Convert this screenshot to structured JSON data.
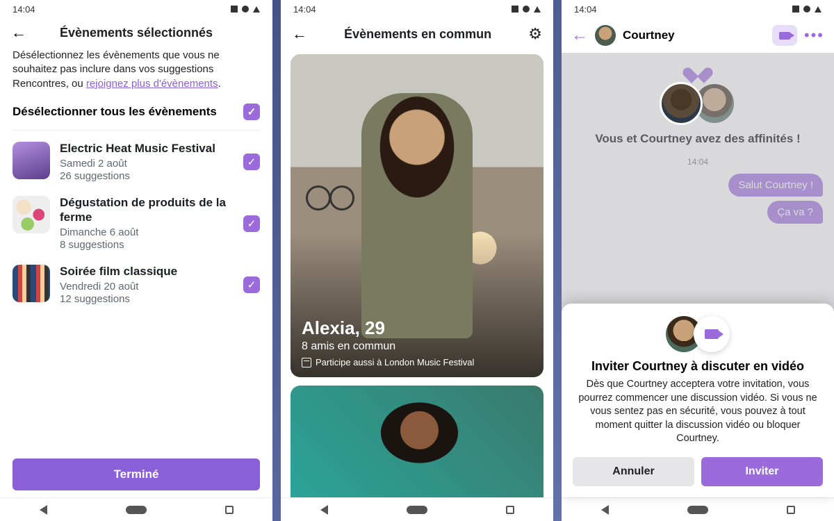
{
  "status": {
    "time": "14:04"
  },
  "colors": {
    "accent": "#9b6bdc",
    "link": "#8a5fd8"
  },
  "screen1": {
    "header_title": "Évènements sélectionnés",
    "instruction_prefix": "Désélectionnez les évènements que vous ne souhaitez pas inclure dans vos suggestions Rencontres, ou ",
    "instruction_link": "rejoignez plus d'évènements",
    "instruction_suffix": ".",
    "deselect_all_label": "Désélectionner tous les évènements",
    "events": [
      {
        "name": "Electric Heat Music Festival",
        "date": "Samedi 2 août",
        "suggestions": "26 suggestions",
        "checked": true
      },
      {
        "name": "Dégustation de produits de la ferme",
        "date": "Dimanche 6 août",
        "suggestions": "8 suggestions",
        "checked": true
      },
      {
        "name": "Soirée film classique",
        "date": "Vendredi 20 août",
        "suggestions": "12 suggestions",
        "checked": true
      }
    ],
    "done_button": "Terminé"
  },
  "screen2": {
    "header_title": "Évènements en commun",
    "profile": {
      "name_age": "Alexia, 29",
      "mutual_friends": "8 amis en commun",
      "event_line": "Participe aussi à London Music Festival"
    }
  },
  "screen3": {
    "contact_name": "Courtney",
    "affinity_text": "Vous et Courtney avez des affinités !",
    "chat_time": "14:04",
    "messages": [
      "Salut Courtney !",
      "Ça va ?"
    ],
    "sheet": {
      "title": "Inviter Courtney à discuter en vidéo",
      "description": "Dès que Courtney acceptera votre invitation, vous pourrez commencer une discussion vidéo. Si vous ne vous sentez pas en sécurité, vous pouvez à tout moment quitter la discussion vidéo ou bloquer Courtney.",
      "cancel": "Annuler",
      "invite": "Inviter"
    }
  }
}
